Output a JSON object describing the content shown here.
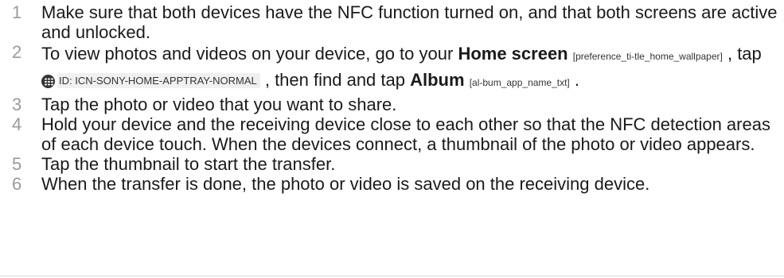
{
  "steps": [
    {
      "number": "1",
      "text": "Make sure that both devices have the NFC function turned on, and that both screens are active and unlocked."
    },
    {
      "number": "2",
      "text_a": "To view photos and videos on your device, go to your ",
      "home_screen": "Home screen",
      "home_ref": "[preference_ti-tle_home_wallpaper]",
      "text_b": " , tap ",
      "icon_id": "ID: ICN-SONY-HOME-APPTRAY-NORMAL",
      "text_c": " , then find and tap ",
      "album": "Album",
      "album_ref": "[al-bum_app_name_txt]",
      "text_d": " ."
    },
    {
      "number": "3",
      "text": "Tap the photo or video that you want to share."
    },
    {
      "number": "4",
      "text": "Hold your device and the receiving device close to each other so that the NFC detection areas of each device touch. When the devices connect, a thumbnail of the photo or video appears."
    },
    {
      "number": "5",
      "text": "Tap the thumbnail to start the transfer."
    },
    {
      "number": "6",
      "text": "When the transfer is done, the photo or video is saved on the receiving device."
    }
  ],
  "icons": {
    "apptray": "apps-grid-icon"
  }
}
